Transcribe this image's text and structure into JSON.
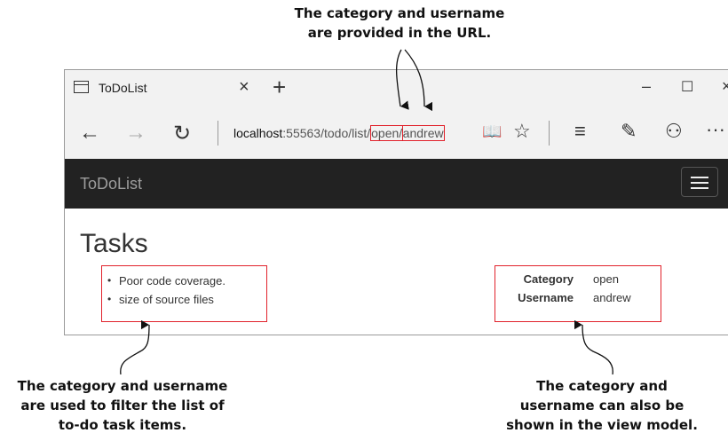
{
  "callouts": {
    "top": [
      "The category and username",
      "are provided in the URL."
    ],
    "left": [
      "The category and username",
      "are used to filter the list of",
      "to-do task items."
    ],
    "right": [
      "The category and",
      "username can also be",
      "shown in the view model."
    ]
  },
  "browser": {
    "tab_title": "ToDoList",
    "tab_close": "×",
    "new_tab": "+",
    "window_controls": {
      "minimize": "–",
      "maximize": "☐",
      "close": "×"
    },
    "nav": {
      "back": "←",
      "forward": "→",
      "refresh": "↻"
    },
    "url": {
      "host": "localhost",
      "path": ":55563/todo/list/",
      "segment_category": "open",
      "slash": "/",
      "segment_username": "andrew"
    },
    "tools": {
      "reading_view": "📖",
      "favorites": "☆",
      "hub": "≡",
      "notes": "✎",
      "share": "⚇",
      "more": "···"
    }
  },
  "site": {
    "brand": "ToDoList",
    "heading": "Tasks",
    "tasks": [
      "Poor code coverage.",
      "size of source files"
    ],
    "info": [
      {
        "key": "Category",
        "value": "open"
      },
      {
        "key": "Username",
        "value": "andrew"
      }
    ]
  },
  "colors": {
    "highlight": "#e1222b",
    "navbar": "#222222",
    "chrome": "#f2f2f2"
  }
}
